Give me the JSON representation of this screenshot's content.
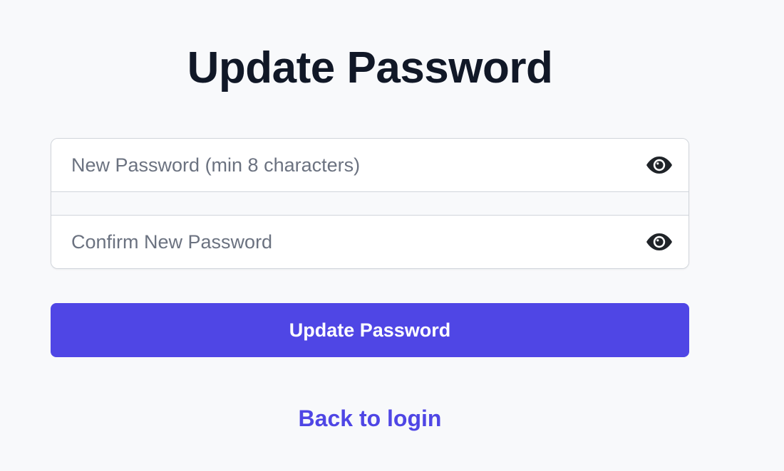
{
  "page": {
    "title": "Update Password"
  },
  "form": {
    "new_password": {
      "placeholder": "New Password (min 8 characters)",
      "value": "",
      "toggle_icon": "eye-icon"
    },
    "confirm_password": {
      "placeholder": "Confirm New Password",
      "value": "",
      "toggle_icon": "eye-icon"
    },
    "submit_label": "Update Password"
  },
  "footer": {
    "back_link_label": "Back to login"
  },
  "colors": {
    "accent": "#4f46e5",
    "background": "#f8f9fb",
    "title": "#111827",
    "placeholder": "#6b7280",
    "border": "#d1d5db"
  }
}
